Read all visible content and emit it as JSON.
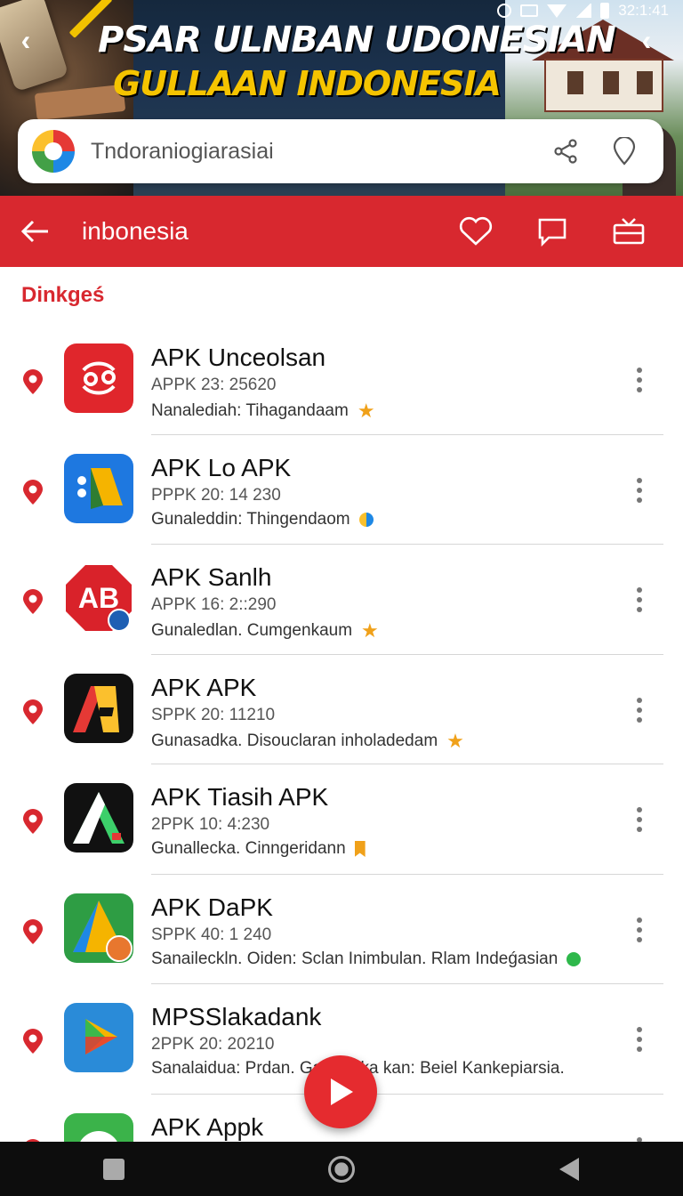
{
  "status_bar": {
    "time": "32:1:41"
  },
  "banner": {
    "title_line1": "PSAR ULNBAN UDONESIAN",
    "title_line2": "GULLAAN INDONESIA"
  },
  "search": {
    "text": "Tndoraniogiarasiai"
  },
  "app_bar": {
    "title": "inbonesia"
  },
  "section_label": "Dinkgeś",
  "apps": [
    {
      "name": "APK Unceolsan",
      "meta": "APPK 23: 25620",
      "desc": "Nanalediah: Tihagandaam"
    },
    {
      "name": "APK Lo APK",
      "meta": "PPPK 20: 14 230",
      "desc": "Gunaleddin: Thingendaom"
    },
    {
      "name": "APK Sanlh",
      "meta": "APPK 16: 2::290",
      "desc": "Gunaledlan. Cumgenkaum"
    },
    {
      "name": "APK APK",
      "meta": "SPPK 20: 11210",
      "desc": "Gunasadka. Disouclaran inholadedam"
    },
    {
      "name": "APK Tiasih APK",
      "meta": "2PPK 10: 4:230",
      "desc": "Gunallecka. Cinngeridann"
    },
    {
      "name": "APK DaPK",
      "meta": "SPPK 40: 1 240",
      "desc": "Sanaileckln. Oiden: Sclan Inimbulan. Rlam Indeǵasian"
    },
    {
      "name": "MPSSlakadank",
      "meta": "2PPK 20: 20210",
      "desc": "Sanalaidua: Prdan. Ga hurnka kan: Beiel Kankepiarsia."
    },
    {
      "name": "APK Appk",
      "meta": "",
      "desc": ""
    }
  ],
  "colors": {
    "accent": "#d8282f",
    "star": "#f0a11a"
  }
}
